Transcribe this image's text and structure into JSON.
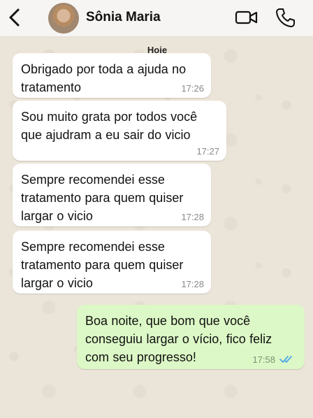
{
  "header": {
    "contact_name": "Sônia Maria"
  },
  "chat": {
    "date_label": "Hoje",
    "messages": [
      {
        "direction": "incoming",
        "text": "Obrigado por toda a ajuda no tratamento",
        "time": "17:26"
      },
      {
        "direction": "incoming",
        "text": "Sou muito grata por todos você que ajudram a eu sair do vicio",
        "time": "17:27"
      },
      {
        "direction": "incoming",
        "text": "Sempre recomendei esse tratamento para quem quiser largar o vicio",
        "time": "17:28"
      },
      {
        "direction": "incoming",
        "text": "Sempre recomendei esse tratamento para quem quiser largar o vicio",
        "time": "17:28"
      },
      {
        "direction": "outgoing",
        "text": "Boa noite, que bom que você conseguiu largar o vício, fico feliz com seu progresso!",
        "time": "17:58",
        "status_icon": "double-check-read-icon"
      }
    ]
  },
  "icons": {
    "back": "chevron-left-icon",
    "video": "video-camera-icon",
    "call": "phone-icon"
  },
  "colors": {
    "incoming_bubble": "#ffffff",
    "outgoing_bubble": "#dcf8c6",
    "read_ticks": "#4fa8e8"
  }
}
